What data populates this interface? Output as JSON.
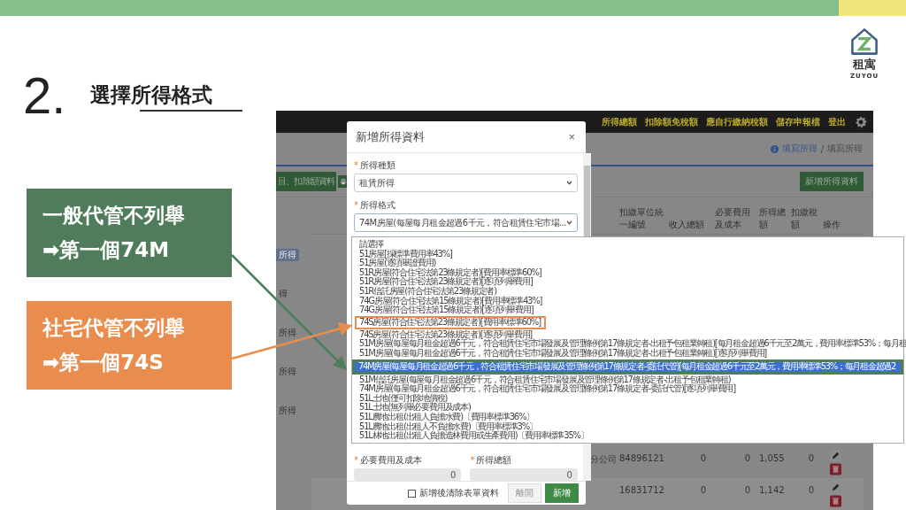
{
  "slide": {
    "step_number": "2.",
    "heading": "選擇所得格式"
  },
  "logo": {
    "name": "租寓",
    "subtitle": "ZUYOU"
  },
  "callouts": [
    {
      "title": "一般代管不列舉",
      "target": "➡第一個74M",
      "color": "#4f7d5b"
    },
    {
      "title": "社宅代管不列舉",
      "target": "➡第一個74S",
      "color": "#e98d4e"
    }
  ],
  "app": {
    "nav_links": [
      "所得總額",
      "扣除額免稅額",
      "應自行繳納稅額",
      "儲存申報檔",
      "登出"
    ],
    "breadcrumb": {
      "link": "填寫所得",
      "separator": "/",
      "current": "填寫所得"
    },
    "toolbar": {
      "left_button": "目、扣除額資料",
      "right_button": "新增所得資料"
    },
    "sidebar_items": [
      {
        "label": "所得",
        "selected": true
      },
      {
        "label": "得",
        "selected": false
      },
      {
        "label": "所得",
        "selected": false
      },
      {
        "label": "所得",
        "selected": false
      },
      {
        "label": "所得",
        "selected": false
      }
    ],
    "table": {
      "columns": [
        "扣繳單位統一編號",
        "收入總額",
        "必要費用及成本",
        "所得總額",
        "扣繳稅額",
        "操作"
      ],
      "rows": [
        {
          "name": "分公司",
          "cells": [
            "84896121",
            "0",
            "0",
            "1,055",
            "0"
          ]
        },
        {
          "name": "",
          "cells": [
            "16831712",
            "0",
            "0",
            "1,142",
            "0"
          ]
        }
      ]
    }
  },
  "modal": {
    "title": "新增所得資料",
    "close": "×",
    "income_type": {
      "required_mark": "*",
      "label": "所得種類",
      "value": "租賃所得"
    },
    "income_format": {
      "required_mark": "*",
      "label": "所得格式",
      "value": "74M房屋(每屋每月租金超過6千元，符合租賃住宅市場..."
    },
    "cost_field": {
      "required_mark": "*",
      "label": "必要費用及成本",
      "value": "0"
    },
    "total_field": {
      "required_mark": "*",
      "label": "所得總額",
      "value": "0"
    },
    "clear_checkbox": {
      "label": "新增後清除表單資料",
      "checked": false
    },
    "buttons": [
      "離開",
      "新增"
    ],
    "options": [
      {
        "label": "請選擇",
        "selected": false
      },
      {
        "label": "51房屋[採標準費用率43%]",
        "selected": false
      },
      {
        "label": "51房屋(逐項舉證費用)",
        "selected": false
      },
      {
        "label": "51R房屋(符合住宅法第23條規定者)[費用率標準60%]",
        "selected": false
      },
      {
        "label": "51R房屋(符合住宅法第23條規定者)[逐項列舉費用]",
        "selected": false
      },
      {
        "label": "51R信託房屋(符合住宅法第23條規定者)",
        "selected": false
      },
      {
        "label": "74G房屋(符合住宅法第15條規定者)[費用率標準43%]",
        "selected": false
      },
      {
        "label": "74G房屋(符合住宅法第15條規定者)[逐項列舉費用]",
        "selected": false
      },
      {
        "label": "74S房屋(符合住宅法第23條規定者)[費用率標準60%]",
        "selected": false,
        "color": "#e98d4e"
      },
      {
        "label": "74S房屋(符合住宅法第23條規定者)[逐項列舉費用]",
        "selected": false
      },
      {
        "label": "51M房屋(每屋每月租金超過6千元，符合租賃住宅市場發展及管理條例第17條規定者-出租予包租業轉租)[每月租金超過6千元至2萬元，費用率標準53%；每月租",
        "selected": false
      },
      {
        "label": "51M房屋(每屋每月租金超過6千元，符合租賃住宅市場發展及管理條例第17條規定者-出租予包租業轉租)[逐項列舉費用]",
        "selected": false
      },
      {
        "label": "74M房屋(每屋每月租金超過6千元，符合租賃住宅市場發展及管理條例第17條規定者-委託代管)[每月租金超過6千元至2萬元，費用率標準53%；每月租金超過2",
        "selected": true,
        "color": "#4f7d5b"
      },
      {
        "label": "51M信託房屋(每屋每月租金超過6千元，符合租賃住宅市場發展及管理條例第17條規定者-出租予包租業轉租)",
        "selected": false
      },
      {
        "label": "74M房屋(每屋每月租金超過6千元，符合租賃住宅市場發展及管理條例第17條規定者-委託代管)[逐項列舉費用]",
        "selected": false
      },
      {
        "label": "51L土地(僅可扣除地價稅)",
        "selected": false
      },
      {
        "label": "51L土地(無列舉必要費用及成本)",
        "selected": false
      },
      {
        "label": "51L農地出租(出租人負擔水費)〔費用率標準36%〕",
        "selected": false
      },
      {
        "label": "51L農地出租(出租人不負擔水費)〔費用率標準3%〕",
        "selected": false
      },
      {
        "label": "51L林地出租(出租人負擔造林費用或生產費用)〔費用率標準35%〕",
        "selected": false
      }
    ]
  }
}
